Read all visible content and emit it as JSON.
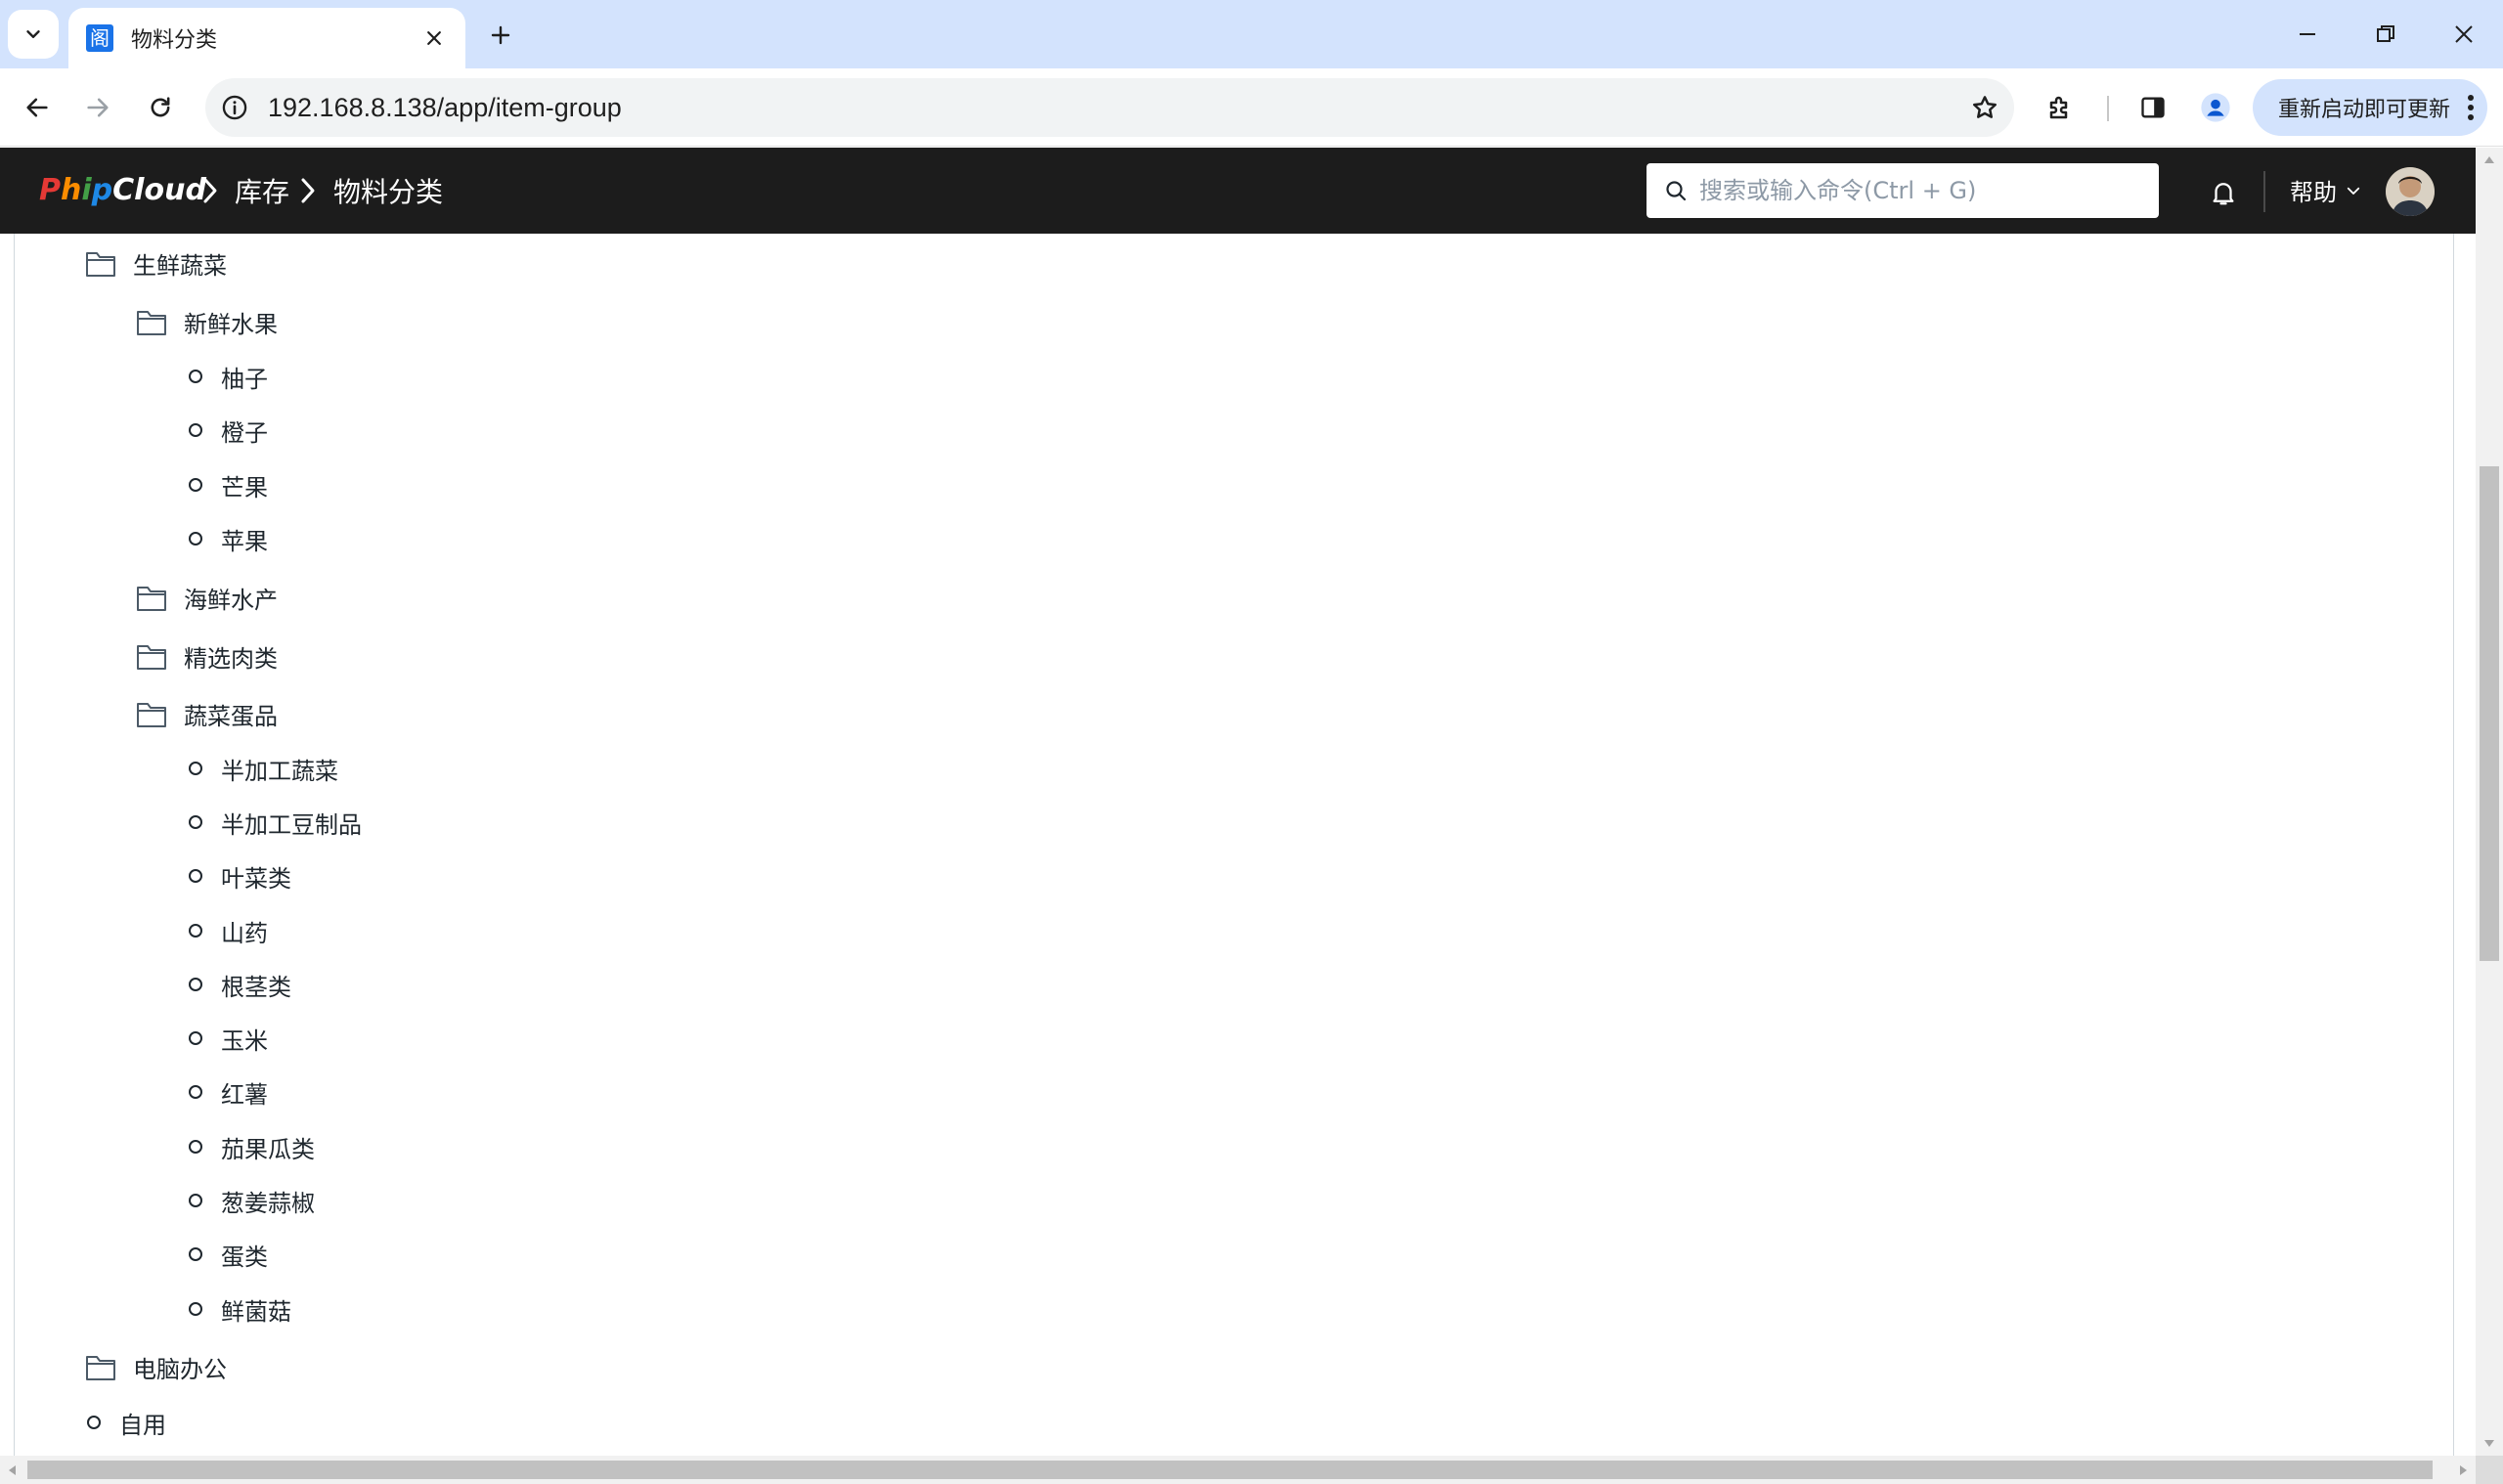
{
  "browser": {
    "tab_title": "物料分类",
    "favicon_glyph": "阁",
    "url": "192.168.8.138/app/item-group",
    "update_label": "重新启动即可更新"
  },
  "navbar": {
    "logo_letters": [
      {
        "ch": "P",
        "color": "#e53935"
      },
      {
        "ch": "h",
        "color": "#fb8c00"
      },
      {
        "ch": "i",
        "color": "#43a047"
      },
      {
        "ch": "p",
        "color": "#1e88e5"
      },
      {
        "ch": "C",
        "color": "#ffffff"
      },
      {
        "ch": "l",
        "color": "#ffffff"
      },
      {
        "ch": "o",
        "color": "#ffffff"
      },
      {
        "ch": "u",
        "color": "#ffffff"
      },
      {
        "ch": "d",
        "color": "#ffffff"
      }
    ],
    "breadcrumbs": [
      "库存",
      "物料分类"
    ],
    "search_placeholder": "搜索或输入命令(Ctrl + G)",
    "help_label": "帮助"
  },
  "tree": [
    {
      "label": "生鲜蔬菜",
      "type": "group",
      "level": 1
    },
    {
      "label": "新鲜水果",
      "type": "group",
      "level": 2
    },
    {
      "label": "柚子",
      "type": "leaf",
      "level": 3
    },
    {
      "label": "橙子",
      "type": "leaf",
      "level": 3
    },
    {
      "label": "芒果",
      "type": "leaf",
      "level": 3
    },
    {
      "label": "苹果",
      "type": "leaf",
      "level": 3
    },
    {
      "label": "海鲜水产",
      "type": "group",
      "level": 2
    },
    {
      "label": "精选肉类",
      "type": "group",
      "level": 2
    },
    {
      "label": "蔬菜蛋品",
      "type": "group",
      "level": 2
    },
    {
      "label": "半加工蔬菜",
      "type": "leaf",
      "level": 3
    },
    {
      "label": "半加工豆制品",
      "type": "leaf",
      "level": 3
    },
    {
      "label": "叶菜类",
      "type": "leaf",
      "level": 3
    },
    {
      "label": "山药",
      "type": "leaf",
      "level": 3
    },
    {
      "label": "根茎类",
      "type": "leaf",
      "level": 3
    },
    {
      "label": "玉米",
      "type": "leaf",
      "level": 3
    },
    {
      "label": "红薯",
      "type": "leaf",
      "level": 3
    },
    {
      "label": "茄果瓜类",
      "type": "leaf",
      "level": 3
    },
    {
      "label": "葱姜蒜椒",
      "type": "leaf",
      "level": 3
    },
    {
      "label": "蛋类",
      "type": "leaf",
      "level": 3
    },
    {
      "label": "鲜菌菇",
      "type": "leaf",
      "level": 3
    },
    {
      "label": "电脑办公",
      "type": "group",
      "level": 1
    },
    {
      "label": "自用",
      "type": "leaf",
      "level": 1
    }
  ]
}
